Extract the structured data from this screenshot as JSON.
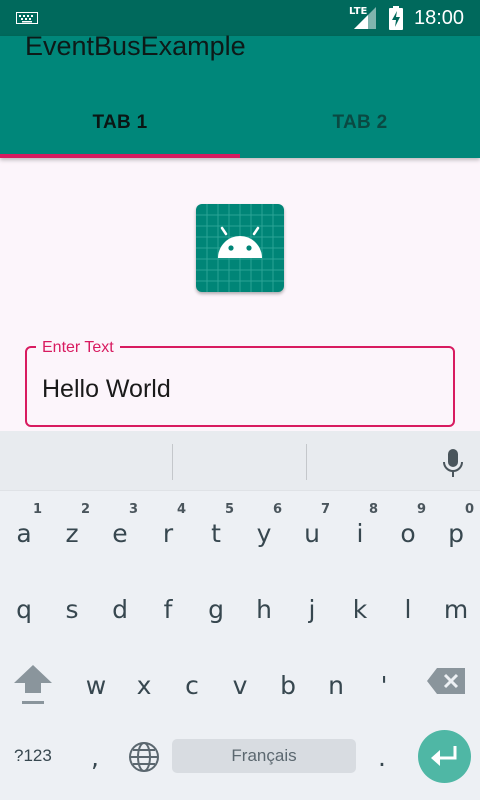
{
  "status_bar": {
    "network": "LTE",
    "time": "18:00",
    "icons": [
      "keyboard-icon",
      "signal-icon",
      "battery-charging-icon"
    ]
  },
  "app_bar": {
    "title": "EventBusExample",
    "tabs": [
      {
        "label": "TAB 1",
        "selected": true
      },
      {
        "label": "TAB 2",
        "selected": false
      }
    ],
    "colors": {
      "bar": "#00877a",
      "indicator": "#d81b60"
    }
  },
  "content": {
    "app_icon": "android-icon",
    "text_field": {
      "label": "Enter Text",
      "value": "Hello World"
    }
  },
  "keyboard": {
    "language": "Français",
    "rows": [
      [
        {
          "key": "a",
          "hint": "1"
        },
        {
          "key": "z",
          "hint": "2"
        },
        {
          "key": "e",
          "hint": "3"
        },
        {
          "key": "r",
          "hint": "4"
        },
        {
          "key": "t",
          "hint": "5"
        },
        {
          "key": "y",
          "hint": "6"
        },
        {
          "key": "u",
          "hint": "7"
        },
        {
          "key": "i",
          "hint": "8"
        },
        {
          "key": "o",
          "hint": "9"
        },
        {
          "key": "p",
          "hint": "0"
        }
      ],
      [
        {
          "key": "q"
        },
        {
          "key": "s"
        },
        {
          "key": "d"
        },
        {
          "key": "f"
        },
        {
          "key": "g"
        },
        {
          "key": "h"
        },
        {
          "key": "j"
        },
        {
          "key": "k"
        },
        {
          "key": "l"
        },
        {
          "key": "m"
        }
      ],
      [
        {
          "key": "w"
        },
        {
          "key": "x"
        },
        {
          "key": "c"
        },
        {
          "key": "v"
        },
        {
          "key": "b"
        },
        {
          "key": "n"
        },
        {
          "key": "'"
        }
      ]
    ],
    "symbols_label": "?123",
    "comma": ",",
    "period": ".",
    "colors": {
      "enter": "#4fb7a5"
    }
  }
}
